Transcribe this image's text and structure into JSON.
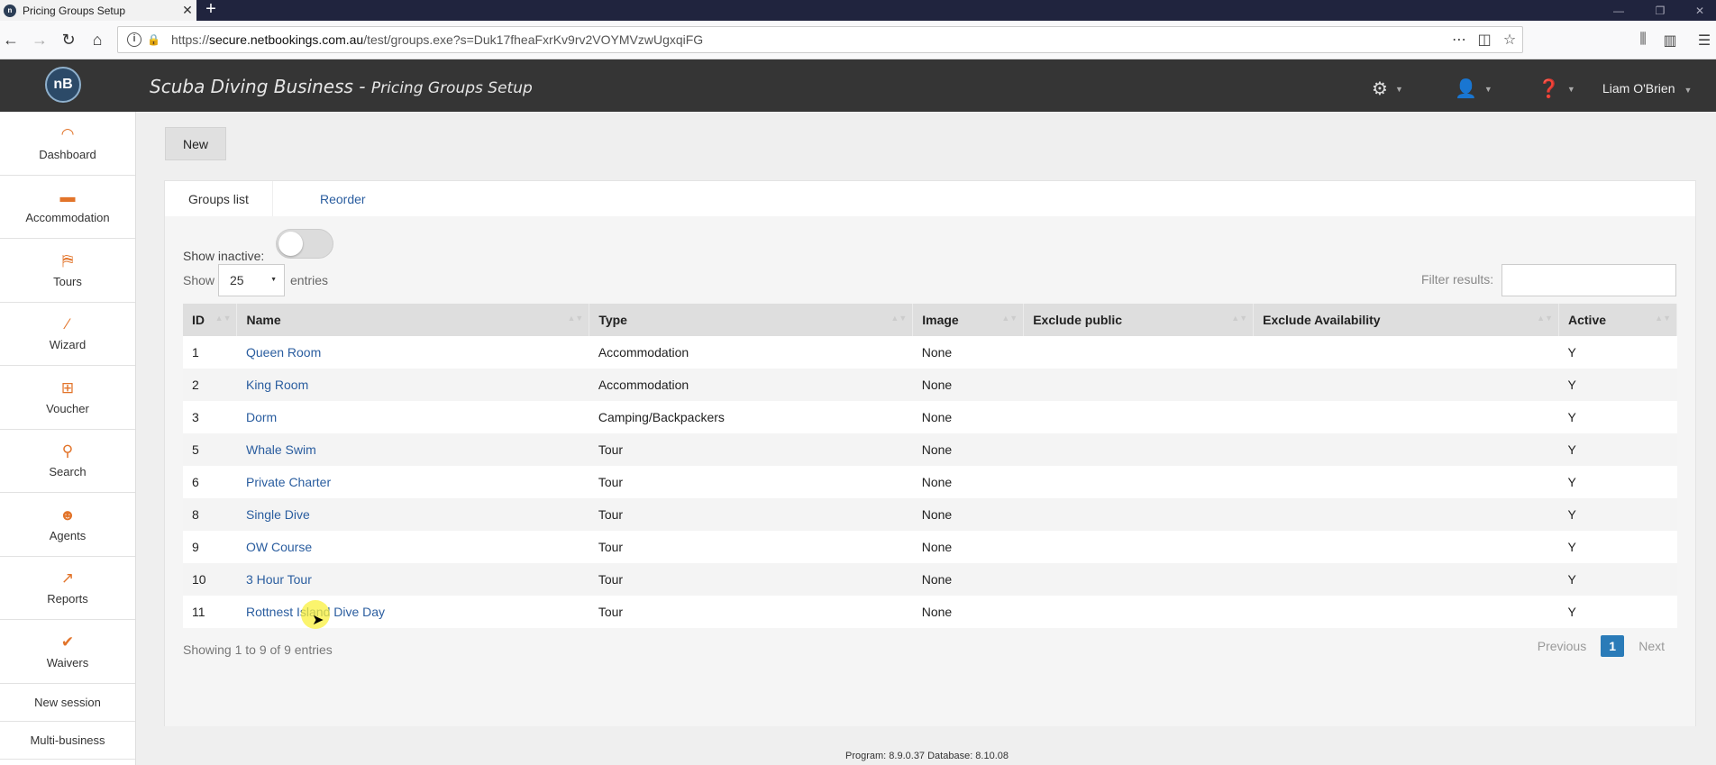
{
  "browser": {
    "tab_title": "Pricing Groups Setup",
    "url_domain": "secure.netbookings.com.au",
    "url_prefix": "https://",
    "url_path": "/test/groups.exe?s=Duk17fheaFxrKv9rv2VOYMVzwUgxqiFG",
    "favicon_text": "n"
  },
  "header": {
    "logo_text": "nB",
    "business": "Scuba Diving Business",
    "separator": " - ",
    "page": "Pricing Groups Setup",
    "user": "Liam O'Brien"
  },
  "sidebar": {
    "items": [
      {
        "label": "Dashboard",
        "icon": "dashboard-icon"
      },
      {
        "label": "Accommodation",
        "icon": "bed-icon"
      },
      {
        "label": "Tours",
        "icon": "tours-icon"
      },
      {
        "label": "Wizard",
        "icon": "wand-icon"
      },
      {
        "label": "Voucher",
        "icon": "gift-icon"
      },
      {
        "label": "Search",
        "icon": "search-icon"
      },
      {
        "label": "Agents",
        "icon": "agent-icon"
      },
      {
        "label": "Reports",
        "icon": "chart-icon"
      },
      {
        "label": "Waivers",
        "icon": "check-icon"
      }
    ],
    "new_session": "New session",
    "multi_business": "Multi-business"
  },
  "toolbar": {
    "new_label": "New"
  },
  "tabs": {
    "groups_list": "Groups list",
    "reorder": "Reorder"
  },
  "controls": {
    "show_inactive": "Show inactive:",
    "show": "Show",
    "entries_value": "25",
    "entries": "entries",
    "filter": "Filter results:"
  },
  "table": {
    "columns": [
      "ID",
      "Name",
      "Type",
      "Image",
      "Exclude public",
      "Exclude Availability",
      "Active"
    ],
    "rows": [
      [
        "1",
        "Queen Room",
        "Accommodation",
        "None",
        "",
        "",
        "Y"
      ],
      [
        "2",
        "King Room",
        "Accommodation",
        "None",
        "",
        "",
        "Y"
      ],
      [
        "3",
        "Dorm",
        "Camping/Backpackers",
        "None",
        "",
        "",
        "Y"
      ],
      [
        "5",
        "Whale Swim",
        "Tour",
        "None",
        "",
        "",
        "Y"
      ],
      [
        "6",
        "Private Charter",
        "Tour",
        "None",
        "",
        "",
        "Y"
      ],
      [
        "8",
        "Single Dive",
        "Tour",
        "None",
        "",
        "",
        "Y"
      ],
      [
        "9",
        "OW Course",
        "Tour",
        "None",
        "",
        "",
        "Y"
      ],
      [
        "10",
        "3 Hour Tour",
        "Tour",
        "None",
        "",
        "",
        "Y"
      ],
      [
        "11",
        "Rottnest Island Dive Day",
        "Tour",
        "None",
        "",
        "",
        "Y"
      ]
    ]
  },
  "pagination": {
    "showing": "Showing 1 to 9 of 9 entries",
    "previous": "Previous",
    "page": "1",
    "next": "Next"
  },
  "footer": {
    "version": "Program: 8.9.0.37 Database: 8.10.08"
  },
  "colors": {
    "accent_orange": "#e2742a",
    "link_blue": "#2a5d9f",
    "header_dark": "#353535"
  }
}
